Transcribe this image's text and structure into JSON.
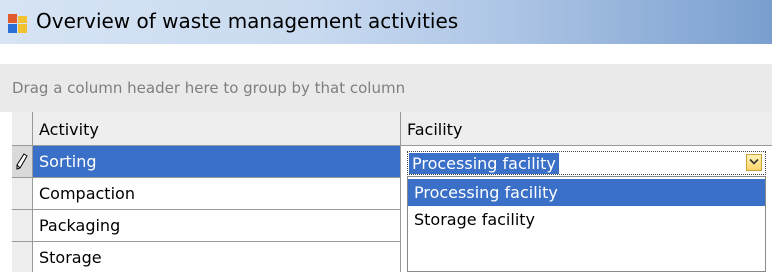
{
  "window": {
    "title": "Overview of waste management activities",
    "icon": "app-grid-icon"
  },
  "group_panel": {
    "hint": "Drag a column header here to group by that column"
  },
  "grid": {
    "columns": [
      "Activity",
      "Facility"
    ],
    "rows": [
      {
        "activity": "Sorting",
        "facility": "Processing facility",
        "editing": true
      },
      {
        "activity": "Compaction",
        "facility": ""
      },
      {
        "activity": "Packaging",
        "facility": ""
      },
      {
        "activity": "Storage",
        "facility": ""
      }
    ],
    "editing_row_icon": "pencil-icon"
  },
  "facility_editor": {
    "value": "Processing facility",
    "dropdown_icon": "chevron-down-icon",
    "options": [
      "Processing facility",
      "Storage facility"
    ],
    "selected_option": "Processing facility"
  },
  "colors": {
    "selection": "#3a70c8",
    "header_bg": "#eeeeee",
    "group_panel_bg": "#eaeaea",
    "dropdown_button": "#ffd56a"
  }
}
